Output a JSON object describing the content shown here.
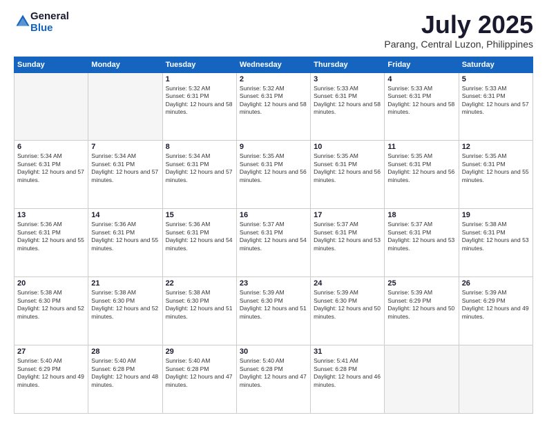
{
  "header": {
    "logo_general": "General",
    "logo_blue": "Blue",
    "title": "July 2025",
    "location": "Parang, Central Luzon, Philippines"
  },
  "days": [
    "Sunday",
    "Monday",
    "Tuesday",
    "Wednesday",
    "Thursday",
    "Friday",
    "Saturday"
  ],
  "weeks": [
    [
      {
        "day": "",
        "sunrise": "",
        "sunset": "",
        "daylight": "",
        "empty": true
      },
      {
        "day": "",
        "sunrise": "",
        "sunset": "",
        "daylight": "",
        "empty": true
      },
      {
        "day": "1",
        "sunrise": "Sunrise: 5:32 AM",
        "sunset": "Sunset: 6:31 PM",
        "daylight": "Daylight: 12 hours and 58 minutes."
      },
      {
        "day": "2",
        "sunrise": "Sunrise: 5:32 AM",
        "sunset": "Sunset: 6:31 PM",
        "daylight": "Daylight: 12 hours and 58 minutes."
      },
      {
        "day": "3",
        "sunrise": "Sunrise: 5:33 AM",
        "sunset": "Sunset: 6:31 PM",
        "daylight": "Daylight: 12 hours and 58 minutes."
      },
      {
        "day": "4",
        "sunrise": "Sunrise: 5:33 AM",
        "sunset": "Sunset: 6:31 PM",
        "daylight": "Daylight: 12 hours and 58 minutes."
      },
      {
        "day": "5",
        "sunrise": "Sunrise: 5:33 AM",
        "sunset": "Sunset: 6:31 PM",
        "daylight": "Daylight: 12 hours and 57 minutes."
      }
    ],
    [
      {
        "day": "6",
        "sunrise": "Sunrise: 5:34 AM",
        "sunset": "Sunset: 6:31 PM",
        "daylight": "Daylight: 12 hours and 57 minutes."
      },
      {
        "day": "7",
        "sunrise": "Sunrise: 5:34 AM",
        "sunset": "Sunset: 6:31 PM",
        "daylight": "Daylight: 12 hours and 57 minutes."
      },
      {
        "day": "8",
        "sunrise": "Sunrise: 5:34 AM",
        "sunset": "Sunset: 6:31 PM",
        "daylight": "Daylight: 12 hours and 57 minutes."
      },
      {
        "day": "9",
        "sunrise": "Sunrise: 5:35 AM",
        "sunset": "Sunset: 6:31 PM",
        "daylight": "Daylight: 12 hours and 56 minutes."
      },
      {
        "day": "10",
        "sunrise": "Sunrise: 5:35 AM",
        "sunset": "Sunset: 6:31 PM",
        "daylight": "Daylight: 12 hours and 56 minutes."
      },
      {
        "day": "11",
        "sunrise": "Sunrise: 5:35 AM",
        "sunset": "Sunset: 6:31 PM",
        "daylight": "Daylight: 12 hours and 56 minutes."
      },
      {
        "day": "12",
        "sunrise": "Sunrise: 5:35 AM",
        "sunset": "Sunset: 6:31 PM",
        "daylight": "Daylight: 12 hours and 55 minutes."
      }
    ],
    [
      {
        "day": "13",
        "sunrise": "Sunrise: 5:36 AM",
        "sunset": "Sunset: 6:31 PM",
        "daylight": "Daylight: 12 hours and 55 minutes."
      },
      {
        "day": "14",
        "sunrise": "Sunrise: 5:36 AM",
        "sunset": "Sunset: 6:31 PM",
        "daylight": "Daylight: 12 hours and 55 minutes."
      },
      {
        "day": "15",
        "sunrise": "Sunrise: 5:36 AM",
        "sunset": "Sunset: 6:31 PM",
        "daylight": "Daylight: 12 hours and 54 minutes."
      },
      {
        "day": "16",
        "sunrise": "Sunrise: 5:37 AM",
        "sunset": "Sunset: 6:31 PM",
        "daylight": "Daylight: 12 hours and 54 minutes."
      },
      {
        "day": "17",
        "sunrise": "Sunrise: 5:37 AM",
        "sunset": "Sunset: 6:31 PM",
        "daylight": "Daylight: 12 hours and 53 minutes."
      },
      {
        "day": "18",
        "sunrise": "Sunrise: 5:37 AM",
        "sunset": "Sunset: 6:31 PM",
        "daylight": "Daylight: 12 hours and 53 minutes."
      },
      {
        "day": "19",
        "sunrise": "Sunrise: 5:38 AM",
        "sunset": "Sunset: 6:31 PM",
        "daylight": "Daylight: 12 hours and 53 minutes."
      }
    ],
    [
      {
        "day": "20",
        "sunrise": "Sunrise: 5:38 AM",
        "sunset": "Sunset: 6:30 PM",
        "daylight": "Daylight: 12 hours and 52 minutes."
      },
      {
        "day": "21",
        "sunrise": "Sunrise: 5:38 AM",
        "sunset": "Sunset: 6:30 PM",
        "daylight": "Daylight: 12 hours and 52 minutes."
      },
      {
        "day": "22",
        "sunrise": "Sunrise: 5:38 AM",
        "sunset": "Sunset: 6:30 PM",
        "daylight": "Daylight: 12 hours and 51 minutes."
      },
      {
        "day": "23",
        "sunrise": "Sunrise: 5:39 AM",
        "sunset": "Sunset: 6:30 PM",
        "daylight": "Daylight: 12 hours and 51 minutes."
      },
      {
        "day": "24",
        "sunrise": "Sunrise: 5:39 AM",
        "sunset": "Sunset: 6:30 PM",
        "daylight": "Daylight: 12 hours and 50 minutes."
      },
      {
        "day": "25",
        "sunrise": "Sunrise: 5:39 AM",
        "sunset": "Sunset: 6:29 PM",
        "daylight": "Daylight: 12 hours and 50 minutes."
      },
      {
        "day": "26",
        "sunrise": "Sunrise: 5:39 AM",
        "sunset": "Sunset: 6:29 PM",
        "daylight": "Daylight: 12 hours and 49 minutes."
      }
    ],
    [
      {
        "day": "27",
        "sunrise": "Sunrise: 5:40 AM",
        "sunset": "Sunset: 6:29 PM",
        "daylight": "Daylight: 12 hours and 49 minutes."
      },
      {
        "day": "28",
        "sunrise": "Sunrise: 5:40 AM",
        "sunset": "Sunset: 6:28 PM",
        "daylight": "Daylight: 12 hours and 48 minutes."
      },
      {
        "day": "29",
        "sunrise": "Sunrise: 5:40 AM",
        "sunset": "Sunset: 6:28 PM",
        "daylight": "Daylight: 12 hours and 47 minutes."
      },
      {
        "day": "30",
        "sunrise": "Sunrise: 5:40 AM",
        "sunset": "Sunset: 6:28 PM",
        "daylight": "Daylight: 12 hours and 47 minutes."
      },
      {
        "day": "31",
        "sunrise": "Sunrise: 5:41 AM",
        "sunset": "Sunset: 6:28 PM",
        "daylight": "Daylight: 12 hours and 46 minutes."
      },
      {
        "day": "",
        "sunrise": "",
        "sunset": "",
        "daylight": "",
        "empty": true
      },
      {
        "day": "",
        "sunrise": "",
        "sunset": "",
        "daylight": "",
        "empty": true
      }
    ]
  ]
}
